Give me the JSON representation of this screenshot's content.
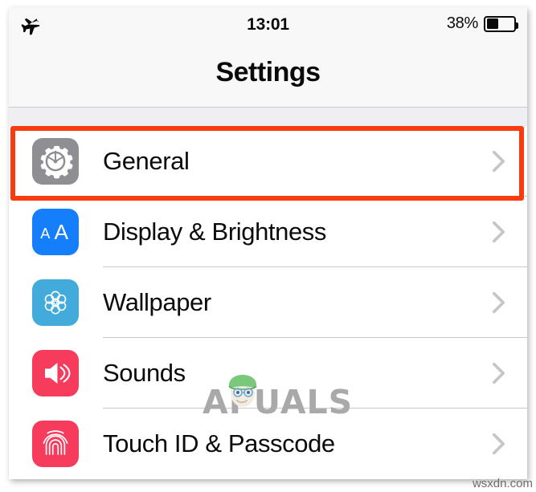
{
  "status_bar": {
    "airplane_icon": "airplane-mode-icon",
    "time": "13:01",
    "battery_percent_label": "38%",
    "battery_level": 38,
    "battery_icon": "battery-icon"
  },
  "nav": {
    "title": "Settings"
  },
  "list": {
    "rows": [
      {
        "label": "General",
        "icon": "gear-icon",
        "icon_color": "#8e8e93",
        "chevron": "chevron-right-icon",
        "highlighted": true
      },
      {
        "label": "Display & Brightness",
        "icon": "text-size-aa-icon",
        "icon_color": "#147efb",
        "chevron": "chevron-right-icon",
        "highlighted": false
      },
      {
        "label": "Wallpaper",
        "icon": "flower-mandala-icon",
        "icon_color": "#43abdb",
        "chevron": "chevron-right-icon",
        "highlighted": false
      },
      {
        "label": "Sounds",
        "icon": "speaker-volume-icon",
        "icon_color": "#f63b5c",
        "chevron": "chevron-right-icon",
        "highlighted": false
      },
      {
        "label": "Touch ID & Passcode",
        "icon": "fingerprint-icon",
        "icon_color": "#f63b5c",
        "chevron": "chevron-right-icon",
        "highlighted": false
      }
    ]
  },
  "annotation": {
    "highlight_color": "#f93b10",
    "target_row": "General"
  },
  "watermarks": {
    "brand": "PUALS",
    "brand_initial": "A",
    "site": "wsxdn.com"
  }
}
